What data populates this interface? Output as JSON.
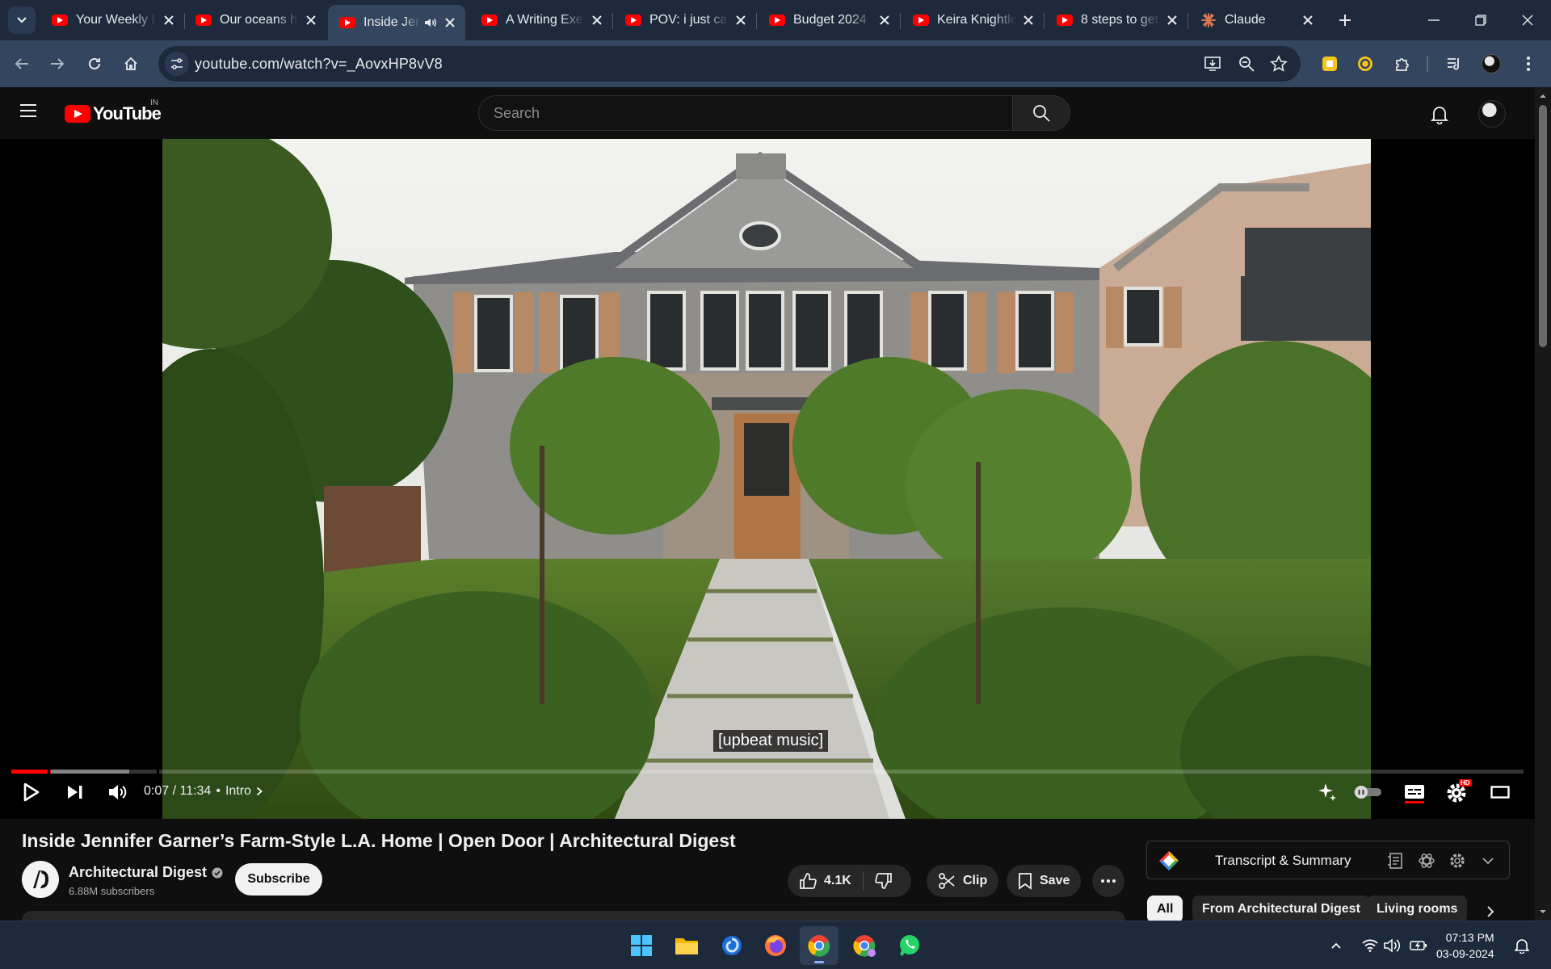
{
  "browser": {
    "tabs": [
      {
        "title": "Your Weekly I",
        "favicon": "youtube-icon"
      },
      {
        "title": "Our oceans h",
        "favicon": "youtube-icon"
      },
      {
        "title": "Inside Jen",
        "favicon": "youtube-icon",
        "active": true,
        "audio": true
      },
      {
        "title": "A Writing Exe",
        "favicon": "youtube-icon"
      },
      {
        "title": "POV: i just ca",
        "favicon": "youtube-icon"
      },
      {
        "title": "Budget 2024",
        "favicon": "youtube-icon"
      },
      {
        "title": "Keira Knightle",
        "favicon": "youtube-icon"
      },
      {
        "title": "8 steps to get",
        "favicon": "youtube-icon"
      },
      {
        "title": "Claude",
        "favicon": "claude-icon"
      }
    ],
    "url": "youtube.com/watch?v=_AovxHP8vV8"
  },
  "youtube": {
    "logo_text": "YouTube",
    "country_code": "IN",
    "search_placeholder": "Search"
  },
  "player": {
    "caption": "[upbeat music]",
    "current_time": "0:07",
    "duration": "11:34",
    "time_display": "0:07 / 11:34",
    "chapter": "Intro",
    "played_fraction": 0.01,
    "buffered_fraction": 0.078,
    "hd_badge": "HD"
  },
  "video": {
    "title": "Inside Jennifer Garner’s Farm-Style L.A. Home | Open Door | Architectural Digest",
    "channel_name": "Architectural Digest",
    "channel_initials": "AD",
    "subscribers": "6.88M subscribers",
    "subscribe_label": "Subscribe",
    "likes": "4.1K",
    "clip_label": "Clip",
    "save_label": "Save"
  },
  "side_panel": {
    "transcript_label": "Transcript & Summary",
    "chips": [
      "All",
      "From Architectural Digest",
      "Living rooms"
    ]
  },
  "taskbar": {
    "time": "07:13 PM",
    "date": "03-09-2024"
  },
  "colors": {
    "accent_red": "#ff0000",
    "tab_bg": "#1e2a3c",
    "toolbar_bg": "#34465f",
    "yt_bg": "#0f0f0f"
  }
}
